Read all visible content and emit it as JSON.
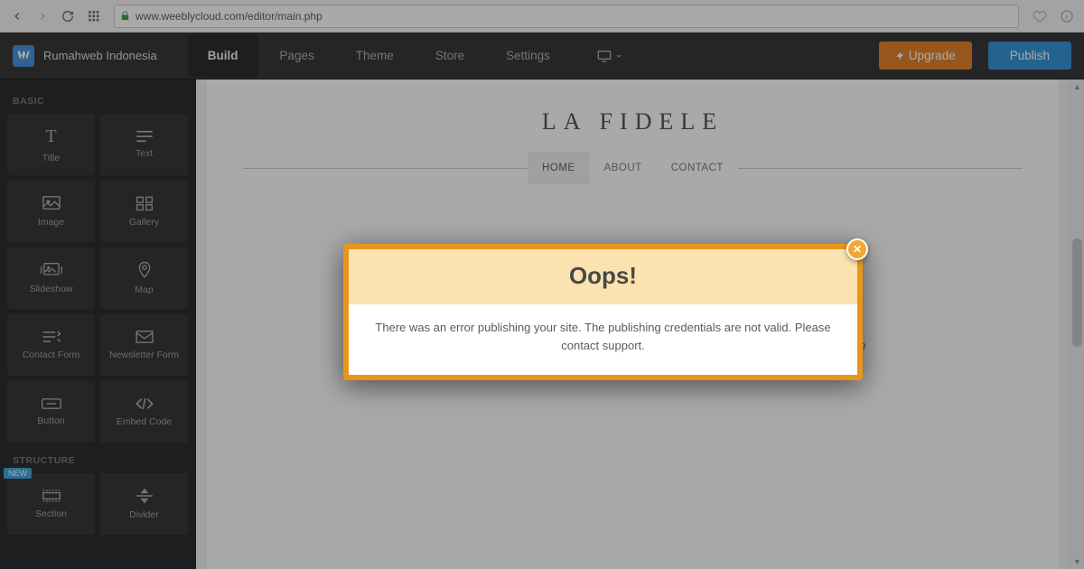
{
  "browser": {
    "url": "www.weeblycloud.com/editor/main.php"
  },
  "app": {
    "site_name": "Rumahweb Indonesia",
    "tabs": {
      "build": "Build",
      "pages": "Pages",
      "theme": "Theme",
      "store": "Store",
      "settings": "Settings"
    },
    "upgrade_label": "Upgrade",
    "publish_label": "Publish"
  },
  "sidebar": {
    "section_basic": "BASIC",
    "section_structure": "STRUCTURE",
    "new_badge": "NEW",
    "items": {
      "title": "Title",
      "text": "Text",
      "image": "Image",
      "gallery": "Gallery",
      "slideshow": "Slideshow",
      "map": "Map",
      "contact_form": "Contact Form",
      "newsletter_form": "Newsletter Form",
      "button": "Button",
      "embed_code": "Embed Code",
      "section": "Section",
      "divider": "Divider"
    }
  },
  "page": {
    "title": "LA FIDELE",
    "nav": {
      "home": "HOME",
      "about": "ABOUT",
      "contact": "CONTACT"
    },
    "tagline": "We're working very hard to bring you some our dignity items directly to your doorstep"
  },
  "modal": {
    "title": "Oops!",
    "body": "There was an error publishing your site. The publishing credentials are not valid. Please contact support."
  }
}
